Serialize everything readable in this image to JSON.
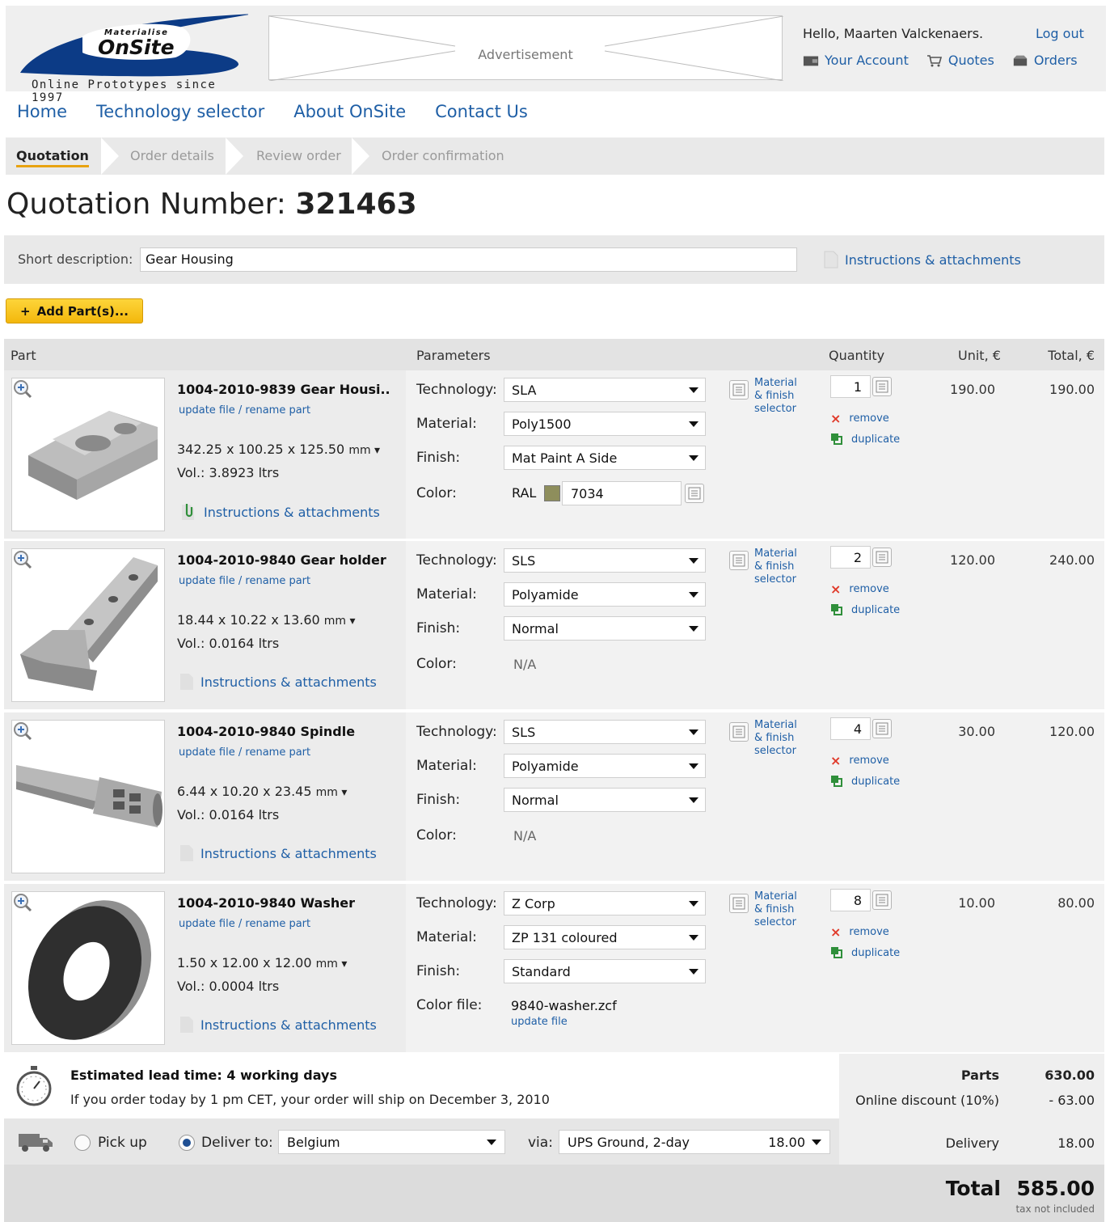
{
  "header": {
    "logo_top": "Materialise",
    "logo_main": "OnSite",
    "logo_tagline": "Online Prototypes since 1997",
    "advertisement": "Advertisement",
    "greeting": "Hello, Maarten Valckenaers.",
    "logout": "Log out",
    "your_account": "Your Account",
    "quotes": "Quotes",
    "orders": "Orders"
  },
  "nav": [
    "Home",
    "Technology selector",
    "About OnSite",
    "Contact Us"
  ],
  "steps": [
    "Quotation",
    "Order details",
    "Review order",
    "Order confirmation"
  ],
  "quotation": {
    "label": "Quotation Number:",
    "number": "321463"
  },
  "short_description": {
    "label": "Short description:",
    "value": "Gear Housing",
    "instructions": "Instructions & attachments"
  },
  "add_parts": "Add Part(s)...",
  "table_headers": {
    "part": "Part",
    "parameters": "Parameters",
    "quantity": "Quantity",
    "unit": "Unit, €",
    "total": "Total, €"
  },
  "labels": {
    "technology": "Technology:",
    "material": "Material:",
    "finish": "Finish:",
    "color": "Color:",
    "color_file": "Color file:",
    "update_file": "update file",
    "rename_part": "rename part",
    "link_sep": " / ",
    "instructions": "Instructions & attachments",
    "mat_sel_1": "Material",
    "mat_sel_2": "& finish",
    "mat_sel_3": "selector",
    "remove": "remove",
    "duplicate": "duplicate",
    "mm": "mm ▾",
    "ral": "RAL"
  },
  "parts": [
    {
      "name": "1004-2010-9839 Gear Housi...",
      "dims": "342.25 x 100.25 x 125.50",
      "vol": "Vol.: 3.8923 ltrs",
      "technology": "SLA",
      "material": "Poly1500",
      "finish": "Mat Paint A Side",
      "color": "7034",
      "quantity": "1",
      "unit": "190.00",
      "total": "190.00"
    },
    {
      "name": "1004-2010-9840 Gear holder",
      "dims": "18.44 x 10.22 x 13.60",
      "vol": "Vol.: 0.0164 ltrs",
      "technology": "SLS",
      "material": "Polyamide",
      "finish": "Normal",
      "color": "N/A",
      "quantity": "2",
      "unit": "120.00",
      "total": "240.00"
    },
    {
      "name": "1004-2010-9840 Spindle",
      "dims": "6.44 x 10.20 x 23.45",
      "vol": "Vol.: 0.0164 ltrs",
      "technology": "SLS",
      "material": "Polyamide",
      "finish": "Normal",
      "color": "N/A",
      "quantity": "4",
      "unit": "30.00",
      "total": "120.00"
    },
    {
      "name": "1004-2010-9840 Washer",
      "dims": "1.50 x 12.00 x 12.00",
      "vol": "Vol.: 0.0004 ltrs",
      "technology": "Z Corp",
      "material": "ZP 131 coloured",
      "finish": "Standard",
      "color_file": "9840-washer.zcf",
      "quantity": "8",
      "unit": "10.00",
      "total": "80.00"
    }
  ],
  "lead": {
    "title": "Estimated lead time: 4 working days",
    "ship": "If you order today by 1 pm CET, your order will ship on December 3, 2010"
  },
  "delivery": {
    "pickup": "Pick up",
    "deliver_to": "Deliver to:",
    "country": "Belgium",
    "via": "via:",
    "method": "UPS Ground, 2-day",
    "method_price": "18.00"
  },
  "summary": {
    "parts_label": "Parts",
    "parts_value": "630.00",
    "discount_label": "Online discount (10%)",
    "discount_value": "- 63.00",
    "delivery_label": "Delivery",
    "delivery_value": "18.00",
    "total_label": "Total",
    "total_value": "585.00",
    "tax_note": "tax not included"
  },
  "colors": {
    "link": "#1f5fa6",
    "accent": "#f3b70c",
    "logo_blue": "#0c3b86"
  },
  "icons": [
    "account-icon",
    "cart-icon",
    "orders-icon",
    "document-icon",
    "attach-icon",
    "zoom-icon",
    "list-icon",
    "remove-icon",
    "duplicate-icon",
    "stopwatch-icon",
    "truck-icon"
  ]
}
